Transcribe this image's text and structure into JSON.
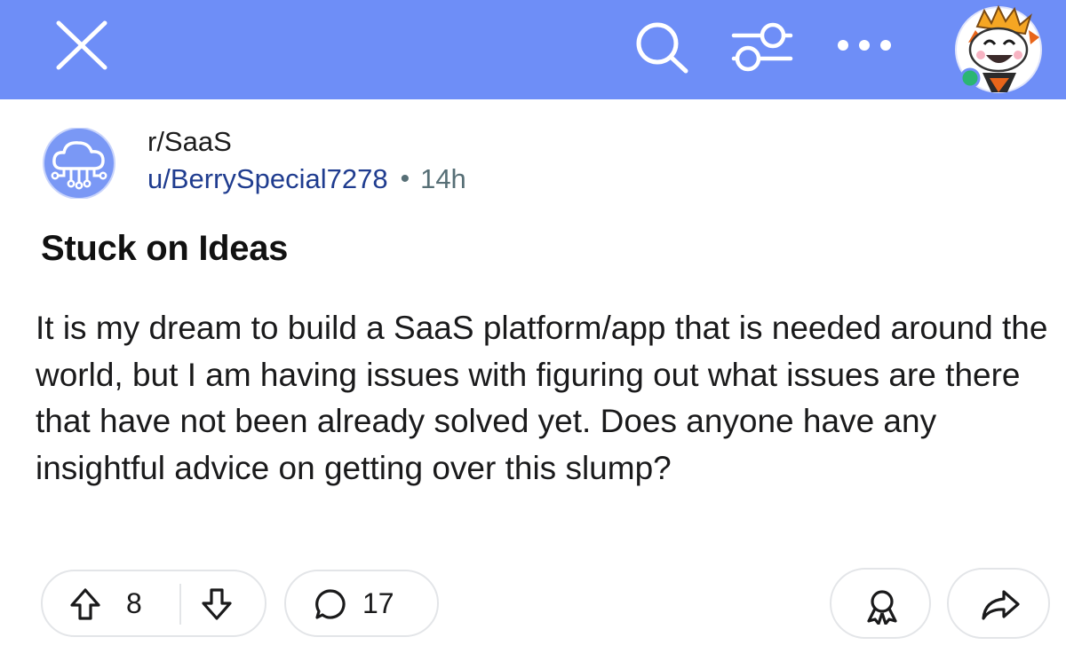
{
  "header": {
    "close_icon": "close-icon",
    "search_icon": "search-icon",
    "filter_icon": "filter-icon",
    "more_icon": "more-icon",
    "accent_color": "#6e8ef7",
    "online_status_color": "#2bb673"
  },
  "post": {
    "community_icon": "cloud-network-icon",
    "subreddit": "r/SaaS",
    "author": "u/BerrySpecial7278",
    "separator": "•",
    "age": "14h",
    "title": "Stuck on Ideas",
    "body": "It is my dream to build a SaaS platform/app that is needed around the world, but I am having issues with figuring out what issues are there that have not been already solved yet. Does anyone have any insightful advice on getting over this slump?"
  },
  "actions": {
    "vote_score": "8",
    "comment_count": "17",
    "award_icon": "award-icon",
    "share_icon": "share-icon"
  }
}
